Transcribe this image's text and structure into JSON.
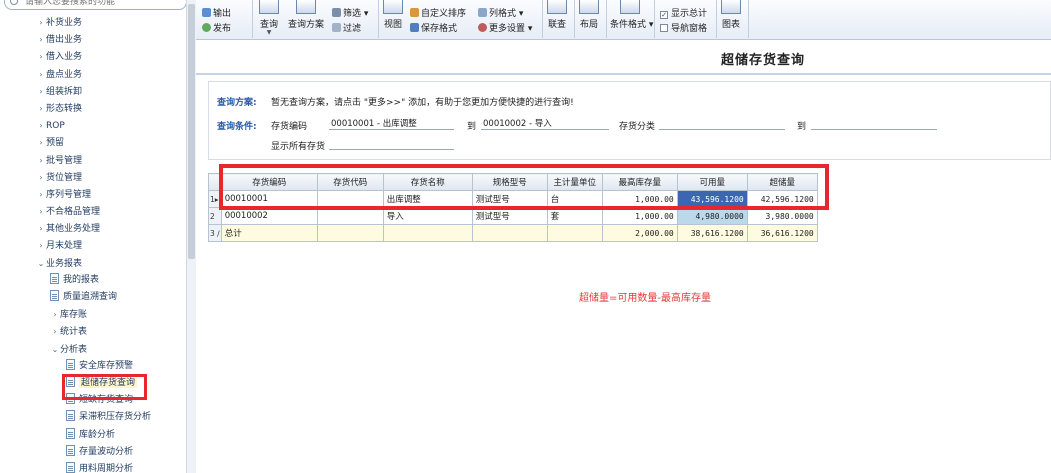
{
  "sidebar": {
    "search_placeholder": "请输入您要搜索的功能",
    "items": [
      {
        "label": "补货业务",
        "arrow": "›",
        "type": "folder"
      },
      {
        "label": "借出业务",
        "arrow": "›",
        "type": "folder"
      },
      {
        "label": "借入业务",
        "arrow": "›",
        "type": "folder"
      },
      {
        "label": "盘点业务",
        "arrow": "›",
        "type": "folder"
      },
      {
        "label": "组装拆卸",
        "arrow": "›",
        "type": "folder"
      },
      {
        "label": "形态转换",
        "arrow": "›",
        "type": "folder"
      },
      {
        "label": "ROP",
        "arrow": "›",
        "type": "folder"
      },
      {
        "label": "预留",
        "arrow": "›",
        "type": "folder"
      },
      {
        "label": "批号管理",
        "arrow": "›",
        "type": "folder"
      },
      {
        "label": "货位管理",
        "arrow": "›",
        "type": "folder"
      },
      {
        "label": "序列号管理",
        "arrow": "›",
        "type": "folder"
      },
      {
        "label": "不合格品管理",
        "arrow": "›",
        "type": "folder"
      },
      {
        "label": "其他业务处理",
        "arrow": "›",
        "type": "folder"
      },
      {
        "label": "月末处理",
        "arrow": "›",
        "type": "folder"
      },
      {
        "label": "业务报表",
        "arrow": "⌄",
        "type": "folder-open"
      },
      {
        "label": "我的报表",
        "type": "doc"
      },
      {
        "label": "质量追溯查询",
        "type": "doc"
      },
      {
        "label": "库存账",
        "arrow": "›",
        "type": "folder"
      },
      {
        "label": "统计表",
        "arrow": "›",
        "type": "folder"
      },
      {
        "label": "分析表",
        "arrow": "⌄",
        "type": "folder-open"
      },
      {
        "label": "安全库存预警",
        "type": "doc"
      },
      {
        "label": "超储存货查询",
        "type": "doc",
        "selected": true
      },
      {
        "label": "短缺存货查询",
        "type": "doc"
      },
      {
        "label": "呆滞积压存货分析",
        "type": "doc"
      },
      {
        "label": "库龄分析",
        "type": "doc"
      },
      {
        "label": "存量波动分析",
        "type": "doc"
      },
      {
        "label": "用料周期分析",
        "type": "doc"
      }
    ]
  },
  "toolbar": {
    "output": "输出",
    "publish": "发布",
    "query": "查询",
    "query_scheme": "查询方案",
    "filter": "筛选",
    "filter_clear": "过滤",
    "view": "视图",
    "custom_sort": "自定义排序",
    "save_format": "保存格式",
    "column_format": "列格式",
    "more_settings": "更多设置",
    "link_query": "联查",
    "layout": "布局",
    "conditional_format": "条件格式",
    "show_total": "显示总计",
    "nav_pane": "导航窗格",
    "chart": "图表"
  },
  "page": {
    "title": "超储存货查询"
  },
  "query": {
    "scheme_label": "查询方案:",
    "scheme_hint": "暂无查询方案，请点击 \"更多>>\" 添加，有助于您更加方便快捷的进行查询!",
    "cond_label": "查询条件:",
    "inv_code_label": "存货编码",
    "inv_code_from": "00010001 - 出库调整",
    "to_label": "到",
    "inv_code_to": "00010002 - 导入",
    "inv_class_label": "存货分类",
    "inv_class_from": "",
    "to_label2": "到",
    "inv_class_to": "",
    "show_all_label": "显示所有存货",
    "show_all_value": ""
  },
  "grid": {
    "columns": [
      "存货编码",
      "存货代码",
      "存货名称",
      "规格型号",
      "主计量单位",
      "最高库存量",
      "可用量",
      "超储量"
    ],
    "rows": [
      {
        "num": "1",
        "ind": "▸",
        "cells": [
          "00010001",
          "",
          "出库调整",
          "测试型号",
          "台",
          "1,000.00",
          "43,596.1200",
          "42,596.1200"
        ],
        "selected": true
      },
      {
        "num": "2",
        "ind": "",
        "cells": [
          "00010002",
          "",
          "导入",
          "测试型号",
          "套",
          "1,000.00",
          "4,980.0000",
          "3,980.0000"
        ]
      },
      {
        "num": "3",
        "ind": "∕",
        "cells": [
          "总计",
          "",
          "",
          "",
          "",
          "2,000.00",
          "38,616.1200",
          "36,616.1200"
        ],
        "total": true
      }
    ]
  },
  "annotation": {
    "formula": "超储量=可用数量-最高库存量"
  },
  "colors": {
    "highlight": "#e8262d",
    "selected_cell": "#3b66b1",
    "available_col": "#bcd9ea",
    "query_label": "#2a5aa8"
  }
}
